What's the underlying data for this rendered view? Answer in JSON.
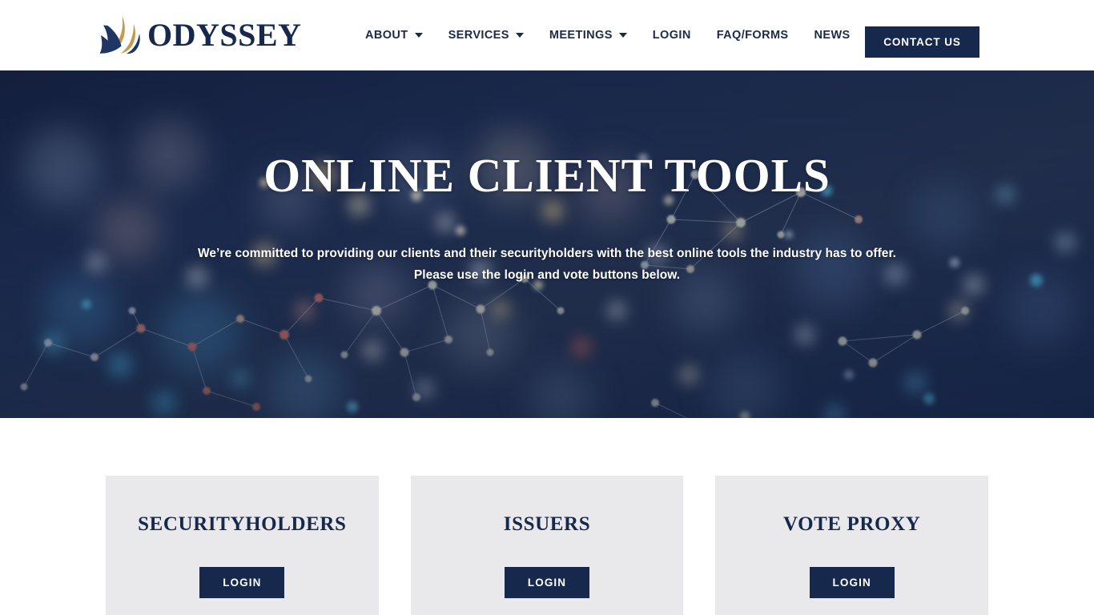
{
  "colors": {
    "navy": "#16294d",
    "gold": "#c69a4e",
    "card_bg": "#e9e9eb",
    "hero_bg": "#17264a",
    "white": "#ffffff"
  },
  "header": {
    "logo": {
      "icon": "odyssey-sail-logo",
      "wordmark": "ODYSSEY"
    },
    "nav_items": [
      {
        "label": "ABOUT",
        "has_dropdown": true,
        "icon": "chevron-down-icon"
      },
      {
        "label": "SERVICES",
        "has_dropdown": true,
        "icon": "chevron-down-icon"
      },
      {
        "label": "MEETINGS",
        "has_dropdown": true,
        "icon": "chevron-down-icon"
      },
      {
        "label": "LOGIN",
        "has_dropdown": false,
        "icon": ""
      },
      {
        "label": "FAQ/FORMS",
        "has_dropdown": false,
        "icon": ""
      },
      {
        "label": "NEWS",
        "has_dropdown": false,
        "icon": ""
      }
    ],
    "contact_button": "CONTACT US"
  },
  "hero": {
    "title": "ONLINE CLIENT TOOLS",
    "subtitle_line1": "We’re committed to providing our clients and their securityholders with the best online tools the industry has to offer.",
    "subtitle_line2": "Please use the login and vote buttons below."
  },
  "cards": [
    {
      "title": "SECURITYHOLDERS",
      "button": "LOGIN"
    },
    {
      "title": "ISSUERS",
      "button": "LOGIN"
    },
    {
      "title": "VOTE PROXY",
      "button": "LOGIN"
    }
  ]
}
